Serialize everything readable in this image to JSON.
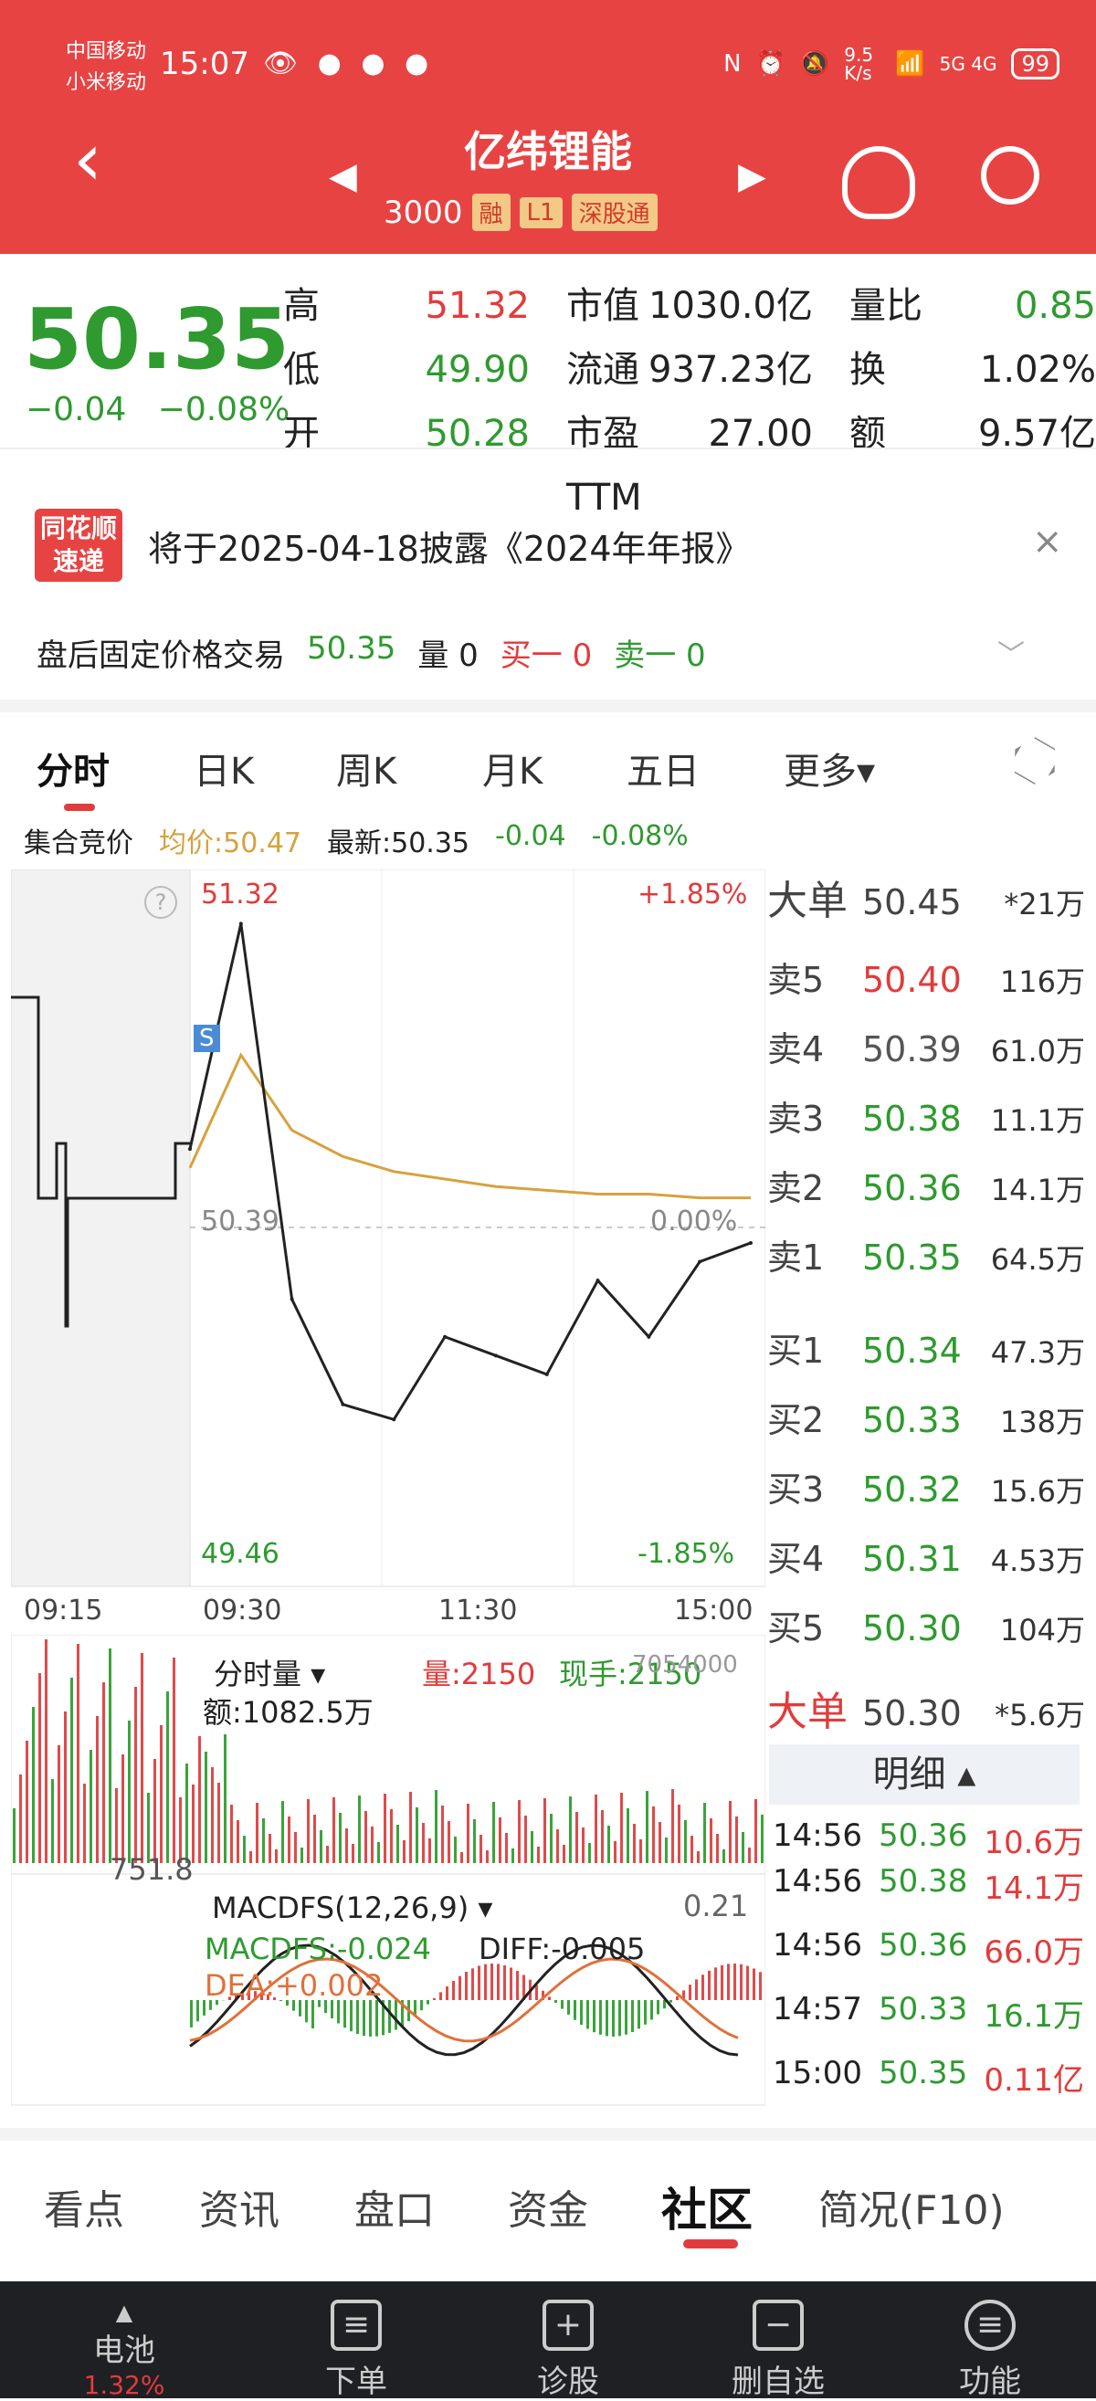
{
  "status_bar": {
    "carrier1": "中国移动",
    "carrier2": "小米移动",
    "time": "15:07",
    "net_speed": "9.5 K/s",
    "signals": "5G 4G",
    "battery": "99"
  },
  "header": {
    "stock_name": "亿纬锂能",
    "stock_code": "3000",
    "badges": [
      "融",
      "L1",
      "深股通"
    ]
  },
  "quote": {
    "price": "50.35",
    "change": "−0.04",
    "change_pct": "−0.08%",
    "high_label": "高",
    "high": "51.32",
    "low_label": "低",
    "low": "49.90",
    "open_label": "开",
    "open": "50.28",
    "mktcap_label": "市值",
    "mktcap": "1030.0亿",
    "float_label": "流通",
    "float": "937.23亿",
    "pe_label": "市盈TTM",
    "pe": "27.00",
    "vol_ratio_label": "量比",
    "vol_ratio": "0.85",
    "turnover_label": "换",
    "turnover": "1.02%",
    "amount_label": "额",
    "amount": "9.57亿"
  },
  "notice": {
    "logo_line1": "同花顺",
    "logo_line2": "速递",
    "text": "将于2025-04-18披露《2024年年报》",
    "close": "×"
  },
  "after_hours": {
    "label": "盘后固定价格交易",
    "price": "50.35",
    "vol": "量 0",
    "buy1": "买一 0",
    "sell1": "卖一 0"
  },
  "tabs": [
    "分时",
    "日K",
    "周K",
    "月K",
    "五日",
    "更多▾"
  ],
  "info_row": {
    "auction": "集合竞价",
    "avg": "均价:50.47",
    "latest": "最新:50.35",
    "chg": "-0.04",
    "chg_pct": "-0.08%"
  },
  "chart": {
    "high": "51.32",
    "low": "49.46",
    "up_pct": "+1.85%",
    "down_pct": "-1.85%",
    "mid": "50.39",
    "mid_pct": "0.00%",
    "times": [
      "09:15",
      "09:30",
      "11:30",
      "15:00"
    ]
  },
  "chart_data": {
    "type": "line",
    "title": "",
    "x": [
      "09:30",
      "09:40",
      "10:00",
      "10:20",
      "10:40",
      "11:00",
      "11:30",
      "13:30",
      "14:00",
      "14:20",
      "14:40",
      "15:00"
    ],
    "series": [
      {
        "name": "",
        "values": [
          50.6,
          51.2,
          50.2,
          49.92,
          49.88,
          50.1,
          50.05,
          50.0,
          50.25,
          50.1,
          50.3,
          50.35
        ]
      },
      {
        "name": "均价",
        "values": [
          50.55,
          50.85,
          50.65,
          50.58,
          50.54,
          50.52,
          50.5,
          50.49,
          50.48,
          50.48,
          50.47,
          50.47
        ]
      }
    ],
    "ylim": [
      49.46,
      51.32
    ]
  },
  "order_book": {
    "big_buy": {
      "label": "大单",
      "price": "50.45",
      "vol": "*21万"
    },
    "asks": [
      {
        "label": "卖5",
        "price": "50.40",
        "vol": "116万",
        "color": "red"
      },
      {
        "label": "卖4",
        "price": "50.39",
        "vol": "61.0万",
        "color": "gray"
      },
      {
        "label": "卖3",
        "price": "50.38",
        "vol": "11.1万",
        "color": "green"
      },
      {
        "label": "卖2",
        "price": "50.36",
        "vol": "14.1万",
        "color": "green"
      },
      {
        "label": "卖1",
        "price": "50.35",
        "vol": "64.5万",
        "color": "green"
      }
    ],
    "bids": [
      {
        "label": "买1",
        "price": "50.34",
        "vol": "47.3万"
      },
      {
        "label": "买2",
        "price": "50.33",
        "vol": "138万"
      },
      {
        "label": "买3",
        "price": "50.32",
        "vol": "15.6万"
      },
      {
        "label": "买4",
        "price": "50.31",
        "vol": "4.53万"
      },
      {
        "label": "买5",
        "price": "50.30",
        "vol": "104万"
      }
    ],
    "big_sell": {
      "label": "大单",
      "price": "50.30",
      "vol": "*5.6万"
    },
    "detail_btn": "明细 ▴"
  },
  "trades": [
    {
      "time": "14:56",
      "price": "50.36",
      "vol": "10.6万",
      "color": "red"
    },
    {
      "time": "14:56",
      "price": "50.38",
      "vol": "14.1万",
      "color": "red"
    },
    {
      "time": "14:56",
      "price": "50.36",
      "vol": "66.0万",
      "color": "red"
    },
    {
      "time": "14:57",
      "price": "50.33",
      "vol": "16.1万",
      "color": "green"
    },
    {
      "time": "15:00",
      "price": "50.35",
      "vol": "0.11亿",
      "color": "red"
    }
  ],
  "volume_panel": {
    "title": "分时量 ▾",
    "vol": "量:2150",
    "hand": "现手:2150",
    "amount": "额:1082.5万",
    "ref": "751.8",
    "max": "7054000"
  },
  "macd_panel": {
    "title": "MACDFS(12,26,9) ▾",
    "macdfs": "MACDFS:-0.024",
    "diff": "DIFF:-0.005",
    "dea": "DEA:+0.002",
    "max": "0.21"
  },
  "bottom_tabs": [
    "看点",
    "资讯",
    "盘口",
    "资金",
    "社区",
    "简况(F10)"
  ],
  "nav": [
    {
      "label": "电池",
      "sub": "1.32%",
      "icon": "▲"
    },
    {
      "label": "下单",
      "icon": "≡"
    },
    {
      "label": "诊股",
      "icon": "+"
    },
    {
      "label": "删自选",
      "icon": "−"
    },
    {
      "label": "功能",
      "icon": "≡"
    }
  ]
}
